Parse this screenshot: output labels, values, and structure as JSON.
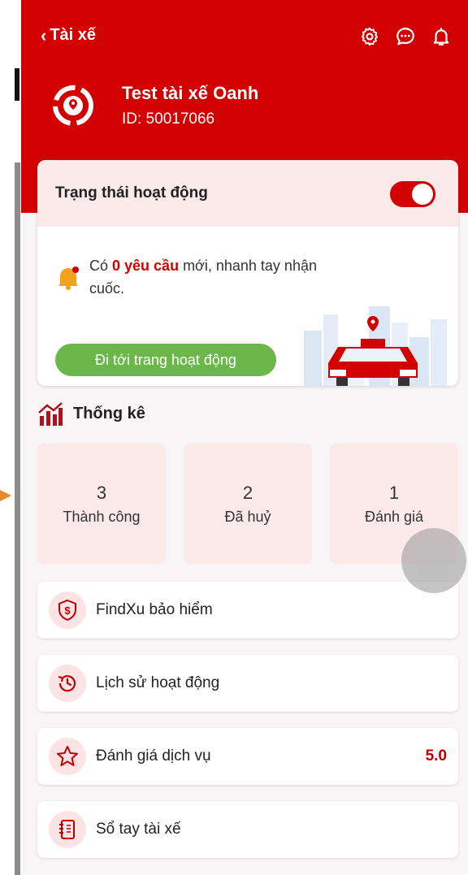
{
  "header": {
    "back_label": "Tài xế",
    "icons": [
      "settings-icon",
      "chat-icon",
      "notification-icon"
    ],
    "background_color": "#d30000"
  },
  "profile": {
    "name": "Test tài xế Oanh",
    "id_text": "ID: 50017066"
  },
  "status_card": {
    "title": "Trạng thái hoạt động",
    "toggle_on": true,
    "notice_prefix": "Có ",
    "notice_highlight": "0 yêu cầu",
    "notice_suffix": " mới, nhanh tay nhận cuốc.",
    "button_label": "Đi tới trang hoạt động",
    "button_color": "#6bb74a"
  },
  "stats": {
    "title": "Thống kê",
    "items": [
      {
        "value": "3",
        "label": "Thành công"
      },
      {
        "value": "2",
        "label": "Đã huỷ"
      },
      {
        "value": "1",
        "label": "Đánh giá"
      }
    ]
  },
  "menu": {
    "items": [
      {
        "icon": "shield-dollar-icon",
        "label": "FindXu bảo hiểm",
        "value": ""
      },
      {
        "icon": "history-clock-icon",
        "label": "Lịch sử hoạt động",
        "value": ""
      },
      {
        "icon": "star-icon",
        "label": "Đánh giá dịch vụ",
        "value": "5.0"
      },
      {
        "icon": "notebook-icon",
        "label": "Sổ tay tài xế",
        "value": ""
      }
    ]
  },
  "colors": {
    "accent": "#d30000",
    "soft_pink": "#fce9ea"
  }
}
